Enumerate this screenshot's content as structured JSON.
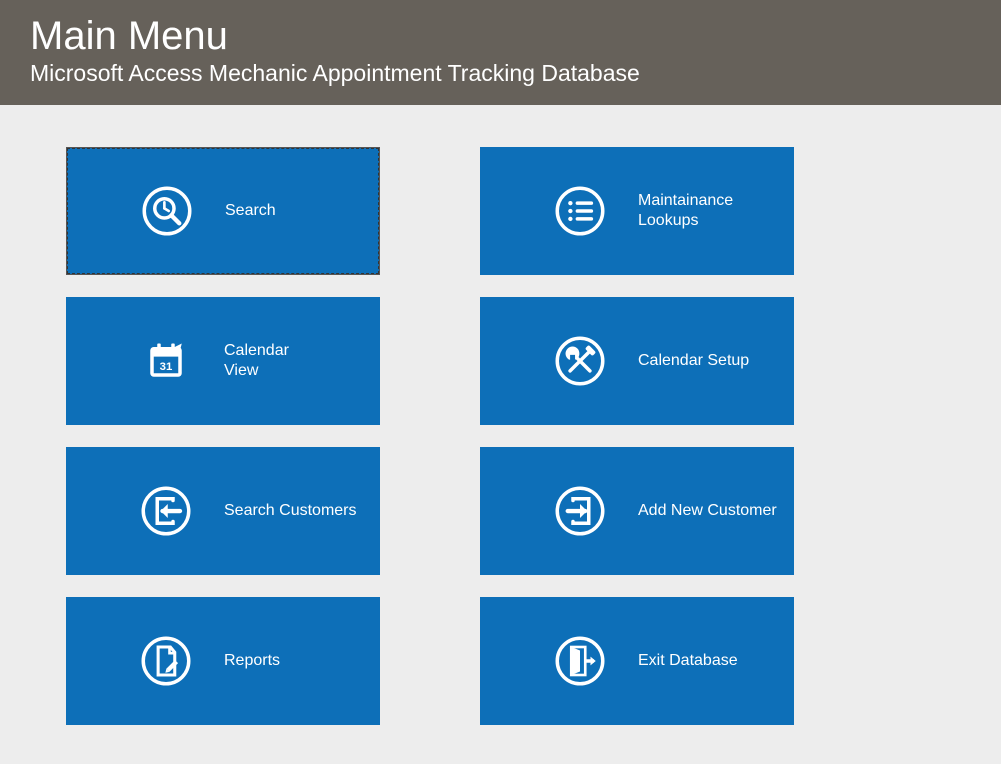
{
  "header": {
    "title": "Main Menu",
    "subtitle": "Microsoft Access Mechanic Appointment Tracking Database"
  },
  "tiles": {
    "search": {
      "label": "Search"
    },
    "maintenance": {
      "label": "Maintainance\nLookups"
    },
    "calendar_view": {
      "label": "Calendar\n  View"
    },
    "calendar_setup": {
      "label": "Calendar Setup"
    },
    "search_customers": {
      "label": "Search Customers"
    },
    "add_new_customer": {
      "label": "Add New Customer"
    },
    "reports": {
      "label": "Reports"
    },
    "exit_database": {
      "label": "Exit Database"
    }
  },
  "colors": {
    "tile_bg": "#0d6fb8",
    "header_bg": "#66615a",
    "page_bg": "#ededed"
  }
}
